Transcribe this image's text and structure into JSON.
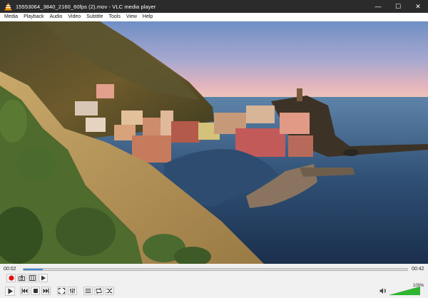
{
  "window": {
    "title": "15553064_3840_2160_60fps (2).mov - VLC media player",
    "minimize_symbol": "—",
    "maximize_symbol": "☐",
    "close_symbol": "✕"
  },
  "menu": {
    "items": [
      "Media",
      "Playback",
      "Audio",
      "Video",
      "Subtitle",
      "Tools",
      "View",
      "Help"
    ]
  },
  "playback": {
    "elapsed": "00:02",
    "total": "00:42",
    "progress_fraction": 0.05
  },
  "volume": {
    "label": "100%",
    "level_fraction": 1.0
  },
  "colors": {
    "titlebar": "#2b2b2b",
    "accent_seek": "#3c8ad8",
    "record": "#e01010",
    "volume_green": "#2fb52f"
  },
  "icons": {
    "app": "vlc-cone-icon",
    "record": "record-icon",
    "snapshot": "camera-icon",
    "loop_ab": "loop-ab-icon",
    "frame_step": "frame-step-icon",
    "play": "play-icon",
    "prev": "previous-icon",
    "stop": "stop-icon",
    "next": "next-icon",
    "fullscreen": "fullscreen-icon",
    "extended": "extended-settings-icon",
    "playlist": "playlist-icon",
    "loop": "loop-icon",
    "shuffle": "shuffle-icon",
    "volume": "speaker-icon"
  }
}
